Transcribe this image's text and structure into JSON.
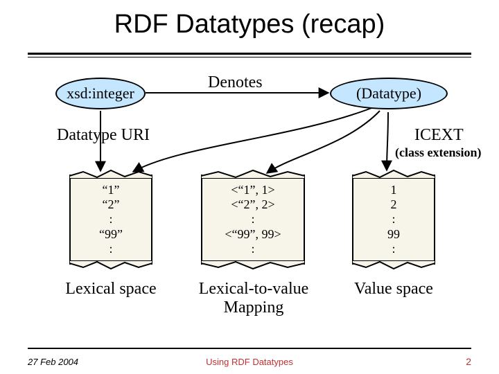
{
  "title": "RDF Datatypes (recap)",
  "nodes": {
    "xsd_integer": "xsd:integer",
    "datatype": "(Datatype)"
  },
  "edges": {
    "denotes": "Denotes",
    "datatype_uri": "Datatype URI",
    "icext": "ICEXT",
    "icext_note": "(class extension)"
  },
  "boxes": {
    "lexical": {
      "l1": "“1”",
      "l2": "“2”",
      "l3": ":",
      "l4": "“99”",
      "l5": ":"
    },
    "mapping": {
      "l1": "<“1”, 1>",
      "l2": "<“2”, 2>",
      "l3": ":",
      "l4": "<“99”, 99>",
      "l5": ":"
    },
    "value": {
      "l1": "1",
      "l2": "2",
      "l3": ":",
      "l4": "99",
      "l5": ":"
    }
  },
  "captions": {
    "lexical_space": "Lexical space",
    "ltv_mapping_1": "Lexical-to-value",
    "ltv_mapping_2": "Mapping",
    "value_space": "Value space"
  },
  "footer": {
    "date": "27 Feb 2004",
    "center": "Using RDF Datatypes",
    "page": "2"
  }
}
